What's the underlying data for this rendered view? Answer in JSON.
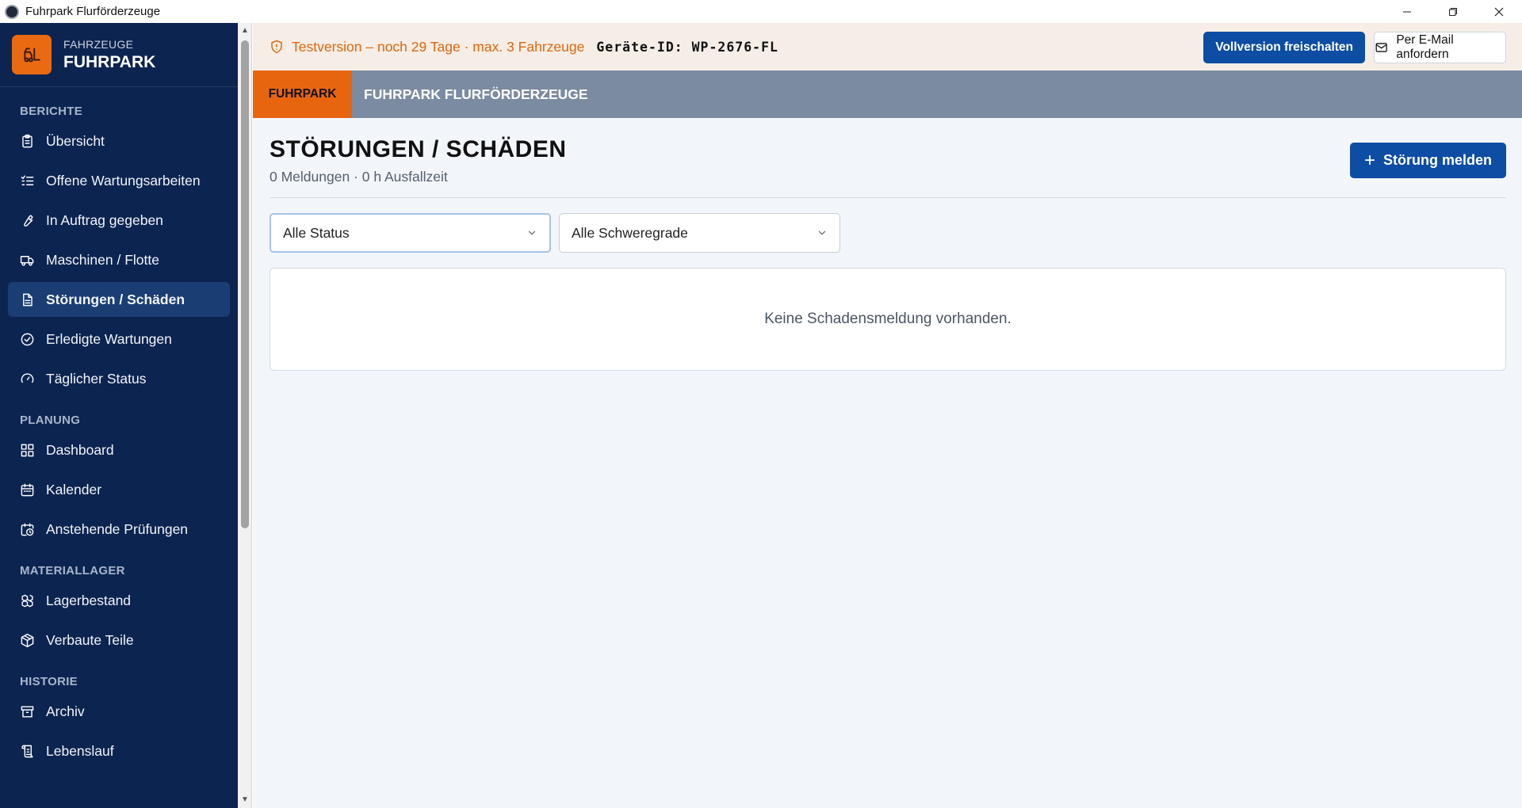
{
  "window": {
    "title": "Fuhrpark Flurförderzeuge"
  },
  "brand": {
    "small": "FAHRZEUGE",
    "big": "FUHRPARK"
  },
  "sidebar": {
    "sections": [
      {
        "title": "BERICHTE",
        "items": [
          {
            "label": "Übersicht",
            "icon": "clipboard-icon"
          },
          {
            "label": "Offene Wartungsarbeiten",
            "icon": "checklist-icon"
          },
          {
            "label": "In Auftrag gegeben",
            "icon": "wrench-icon"
          },
          {
            "label": "Maschinen / Flotte",
            "icon": "truck-icon"
          },
          {
            "label": "Störungen / Schäden",
            "icon": "document-icon",
            "active": true
          },
          {
            "label": "Erledigte Wartungen",
            "icon": "check-circle-icon"
          },
          {
            "label": "Täglicher Status",
            "icon": "gauge-icon"
          }
        ]
      },
      {
        "title": "PLANUNG",
        "items": [
          {
            "label": "Dashboard",
            "icon": "grid-icon"
          },
          {
            "label": "Kalender",
            "icon": "calendar-icon"
          },
          {
            "label": "Anstehende Prüfungen",
            "icon": "calendar-clock-icon"
          }
        ]
      },
      {
        "title": "MATERIALLAGER",
        "items": [
          {
            "label": "Lagerbestand",
            "icon": "boxes-icon"
          },
          {
            "label": "Verbaute Teile",
            "icon": "package-icon"
          }
        ]
      },
      {
        "title": "HISTORIE",
        "items": [
          {
            "label": "Archiv",
            "icon": "archive-icon"
          },
          {
            "label": "Lebenslauf",
            "icon": "scroll-icon"
          }
        ]
      }
    ]
  },
  "trial": {
    "text": "Testversion – noch 29 Tage · max. 3 Fahrzeuge",
    "device_id": "Geräte-ID: WP-2676-FL",
    "unlock_label": "Vollversion freischalten",
    "email_label": "Per E-Mail anfordern"
  },
  "topnav": {
    "tab": "FUHRPARK",
    "title": "FUHRPARK FLURFÖRDERZEUGE"
  },
  "page": {
    "title": "STÖRUNGEN / SCHÄDEN",
    "subtitle": "0 Meldungen · 0 h Ausfallzeit",
    "report_button": "Störung melden",
    "filter_status": "Alle Status",
    "filter_severity": "Alle Schweregrade",
    "empty_message": "Keine Schadensmeldung vorhanden."
  },
  "colors": {
    "sidebar": "#0c2450",
    "accent": "#e8650f",
    "primary": "#0d4da3",
    "trial_text": "#e1660f"
  }
}
